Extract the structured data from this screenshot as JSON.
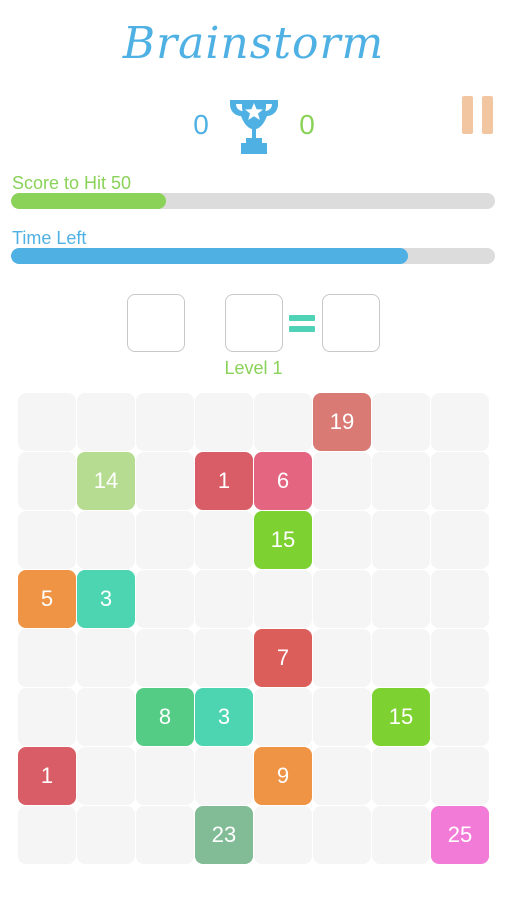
{
  "header": {
    "logo_text": "Brainstorm",
    "score_left": "0",
    "score_right": "0",
    "trophy_icon": "trophy-icon",
    "pause_icon": "pause-icon"
  },
  "progress": {
    "score_label": "Score to Hit 50",
    "score_fraction": 0.32,
    "time_label": "Time Left",
    "time_fraction": 0.82
  },
  "equation": {
    "operand_a": "",
    "operand_b": "",
    "result": "",
    "operator": "="
  },
  "level_label": "Level 1",
  "colors": {
    "blue": "#4fb1e3",
    "green": "#8ad258",
    "pause": "#f3c6a2",
    "equals": "#4fd2b6"
  },
  "board": {
    "rows": 8,
    "cols": 8,
    "tiles": [
      {
        "value": "19",
        "row": 0,
        "col": 5,
        "color": "#d97b74"
      },
      {
        "value": "14",
        "row": 1,
        "col": 1,
        "color": "#b5dc90"
      },
      {
        "value": "1",
        "row": 1,
        "col": 3,
        "color": "#d95d66"
      },
      {
        "value": "6",
        "row": 1,
        "col": 4,
        "color": "#e3657f"
      },
      {
        "value": "15",
        "row": 2,
        "col": 4,
        "color": "#7dd130"
      },
      {
        "value": "5",
        "row": 3,
        "col": 0,
        "color": "#ef9445"
      },
      {
        "value": "3",
        "row": 3,
        "col": 1,
        "color": "#4dd5b1"
      },
      {
        "value": "7",
        "row": 4,
        "col": 4,
        "color": "#dc5e5a"
      },
      {
        "value": "8",
        "row": 5,
        "col": 2,
        "color": "#55cc86"
      },
      {
        "value": "3",
        "row": 5,
        "col": 3,
        "color": "#4dd5b1"
      },
      {
        "value": "15",
        "row": 5,
        "col": 6,
        "color": "#7dd130"
      },
      {
        "value": "1",
        "row": 6,
        "col": 0,
        "color": "#d95d66"
      },
      {
        "value": "9",
        "row": 6,
        "col": 4,
        "color": "#ef9445"
      },
      {
        "value": "23",
        "row": 7,
        "col": 3,
        "color": "#82bc96"
      },
      {
        "value": "25",
        "row": 7,
        "col": 7,
        "color": "#f27bd8"
      }
    ]
  }
}
